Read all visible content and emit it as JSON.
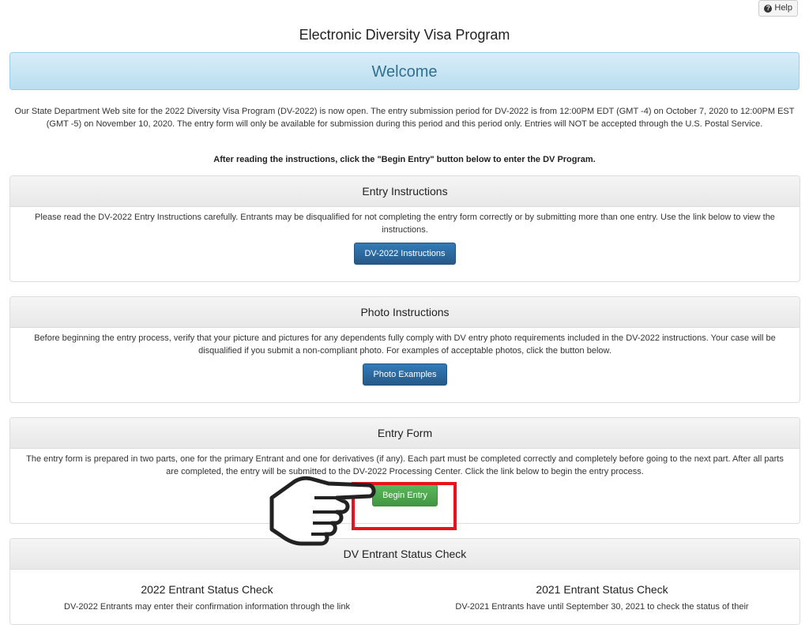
{
  "header": {
    "help_label": "Help",
    "page_title": "Electronic Diversity Visa Program"
  },
  "welcome": {
    "title": "Welcome",
    "intro": "Our State Department Web site for the 2022 Diversity Visa Program (DV-2022) is now open. The entry submission period for DV-2022 is from 12:00PM EDT (GMT -4) on October 7, 2020 to 12:00PM EST (GMT -5) on November 10, 2020. The entry form will only be available for submission during this period and this period only. Entries will NOT be accepted through the U.S. Postal Service.",
    "instruction": "After reading the instructions, click the \"Begin Entry\" button below to enter the DV Program."
  },
  "entry_instructions": {
    "heading": "Entry Instructions",
    "body": "Please read the DV-2022 Entry Instructions carefully. Entrants may be disqualified for not completing the entry form correctly or by submitting more than one entry. Use the link below to view the instructions.",
    "button": "DV-2022 Instructions"
  },
  "photo_instructions": {
    "heading": "Photo Instructions",
    "body": "Before beginning the entry process, verify that your picture and pictures for any dependents fully comply with DV entry photo requirements included in the DV-2022 instructions.  Your case will be disqualified if you submit a non-compliant photo.  For examples of acceptable photos, click the button below.",
    "button": "Photo Examples"
  },
  "entry_form": {
    "heading": "Entry Form",
    "body": "The entry form is prepared in two parts, one for the primary Entrant and one for derivatives (if any). Each part must be completed correctly and completely before going to the next part. After all parts are completed, the entry will be submitted to the DV-2022 Processing Center. Click the link below to begin the entry process.",
    "button": "Begin Entry"
  },
  "status_check": {
    "heading": "DV Entrant Status Check",
    "col_2022": {
      "title": "2022 Entrant Status Check",
      "body": "DV-2022 Entrants may enter their confirmation information through the link"
    },
    "col_2021": {
      "title": "2021 Entrant Status Check",
      "body": "DV-2021 Entrants have until September 30, 2021 to check the status of their"
    }
  },
  "colors": {
    "primary_button": "#337ab7",
    "success_button": "#5cb85c",
    "welcome_bg": "#d9edf7",
    "highlight": "#e8131a"
  },
  "annotations": {
    "pointer_icon": "pointing-hand-icon",
    "highlight_box": "red-rectangle"
  }
}
